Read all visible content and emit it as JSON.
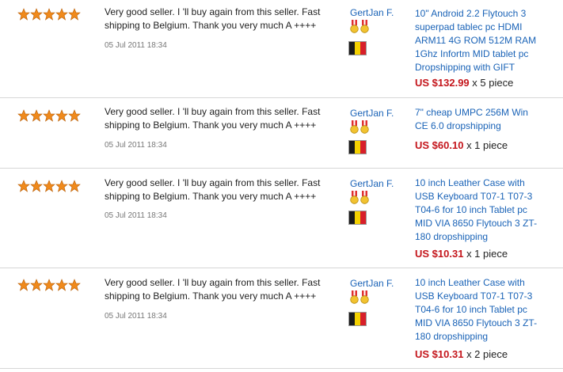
{
  "feedback": [
    {
      "rating": 5,
      "comment": "Very good seller. I 'll buy again from this seller. Fast shipping to Belgium. Thank you very much A ++++",
      "date": "05 Jul 2011 18:34",
      "buyer": "GertJan F.",
      "product": "10\" Android 2.2 Flytouch 3 superpad tablec pc HDMI ARM11 4G ROM 512M RAM 1Ghz Infortm MID tablet pc Dropshipping with GIFT",
      "price": "US $132.99",
      "quantity": "x 5 piece"
    },
    {
      "rating": 5,
      "comment": "Very good seller. I 'll buy again from this seller. Fast shipping to Belgium. Thank you very much A ++++",
      "date": "05 Jul 2011 18:34",
      "buyer": "GertJan F.",
      "product": "7\" cheap UMPC 256M Win CE 6.0 dropshipping",
      "price": "US $60.10",
      "quantity": "x 1 piece"
    },
    {
      "rating": 5,
      "comment": "Very good seller. I 'll buy again from this seller. Fast shipping to Belgium. Thank you very much A ++++",
      "date": "05 Jul 2011 18:34",
      "buyer": "GertJan F.",
      "product": "10 inch Leather Case with USB Keyboard T07-1 T07-3 T04-6 for 10 inch Tablet pc MID VIA 8650 Flytouch 3 ZT-180 dropshipping",
      "price": "US $10.31",
      "quantity": "x 1 piece"
    },
    {
      "rating": 5,
      "comment": "Very good seller. I 'll buy again from this seller. Fast shipping to Belgium. Thank you very much A ++++",
      "date": "05 Jul 2011 18:34",
      "buyer": "GertJan F.",
      "product": "10 inch Leather Case with USB Keyboard T07-1 T07-3 T04-6 for 10 inch Tablet pc MID VIA 8650 Flytouch 3 ZT-180 dropshipping",
      "price": "US $10.31",
      "quantity": "x 2 piece"
    }
  ],
  "colors": {
    "star": "#f08a1c",
    "link": "#1a63b7",
    "price": "#c4161c",
    "divider": "#d6d6d6"
  },
  "icons": [
    "star-icon",
    "medal-icon",
    "belgium-flag-icon"
  ]
}
